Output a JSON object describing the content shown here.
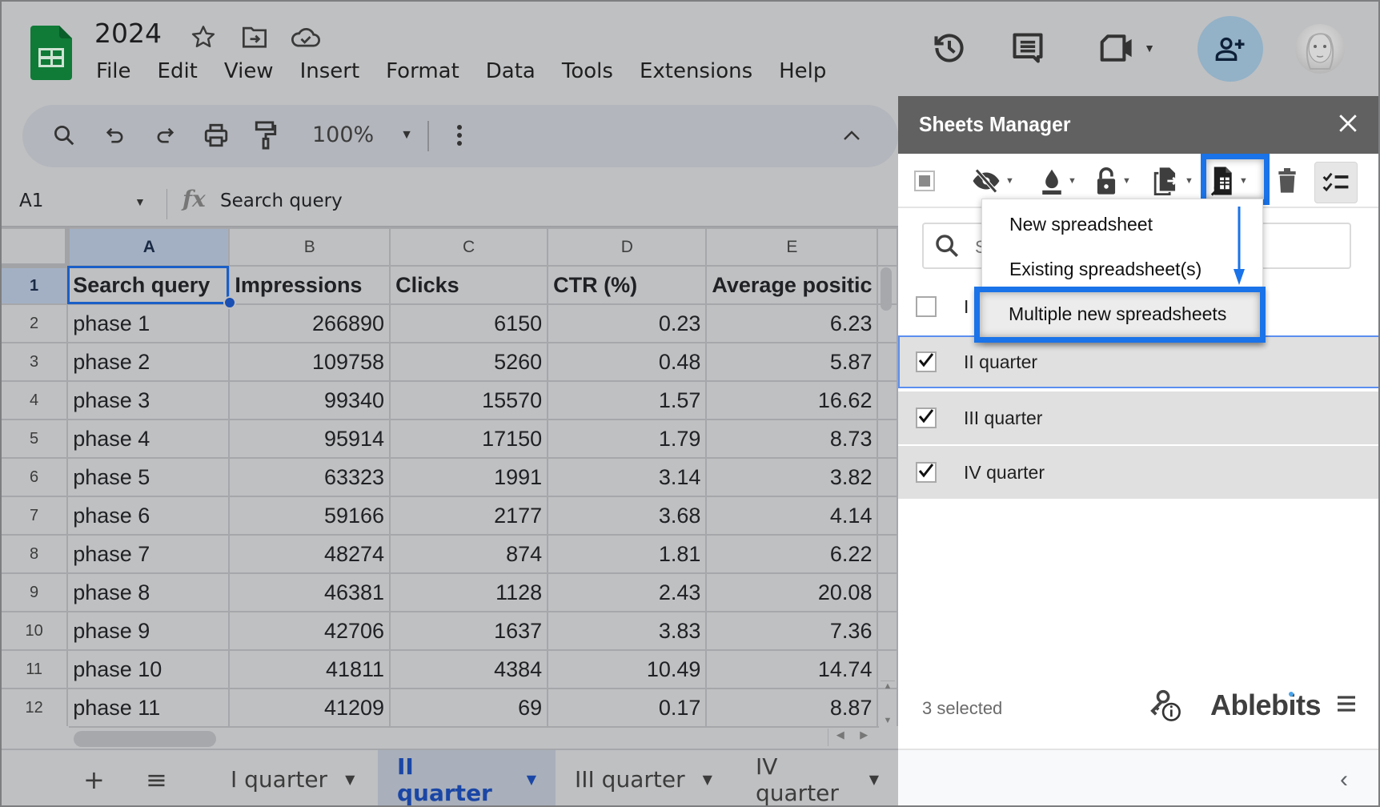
{
  "app": {
    "doc_title": "2024",
    "menu": [
      "File",
      "Edit",
      "View",
      "Insert",
      "Format",
      "Data",
      "Tools",
      "Extensions",
      "Help"
    ],
    "title_icons": [
      "star-icon",
      "move-to-folder-icon",
      "cloud-saved-icon"
    ],
    "top_right_icons": [
      "version-history-icon",
      "comments-icon",
      "meet-icon",
      "share-icon",
      "account-avatar"
    ]
  },
  "toolbar": {
    "zoom": "100%",
    "icons": [
      "search-icon",
      "undo-icon",
      "redo-icon",
      "print-icon",
      "paint-format-icon",
      "more-icon",
      "collapse-icon"
    ]
  },
  "formula_bar": {
    "cell_ref": "A1",
    "fx": "fx",
    "content": "Search query"
  },
  "grid": {
    "columns": [
      "A",
      "B",
      "C",
      "D",
      "E"
    ],
    "active_cell": "A1",
    "rows": [
      {
        "n": "1",
        "cells": [
          "Search query",
          "Impressions",
          "Clicks",
          "CTR (%)",
          "Average positic"
        ]
      },
      {
        "n": "2",
        "cells": [
          "phase 1",
          "266890",
          "6150",
          "0.23",
          "6.23"
        ]
      },
      {
        "n": "3",
        "cells": [
          "phase 2",
          "109758",
          "5260",
          "0.48",
          "5.87"
        ]
      },
      {
        "n": "4",
        "cells": [
          "phase 3",
          "99340",
          "15570",
          "1.57",
          "16.62"
        ]
      },
      {
        "n": "5",
        "cells": [
          "phase 4",
          "95914",
          "17150",
          "1.79",
          "8.73"
        ]
      },
      {
        "n": "6",
        "cells": [
          "phase 5",
          "63323",
          "1991",
          "3.14",
          "3.82"
        ]
      },
      {
        "n": "7",
        "cells": [
          "phase 6",
          "59166",
          "2177",
          "3.68",
          "4.14"
        ]
      },
      {
        "n": "8",
        "cells": [
          "phase 7",
          "48274",
          "874",
          "1.81",
          "6.22"
        ]
      },
      {
        "n": "9",
        "cells": [
          "phase 8",
          "46381",
          "1128",
          "2.43",
          "20.08"
        ]
      },
      {
        "n": "10",
        "cells": [
          "phase 9",
          "42706",
          "1637",
          "3.83",
          "7.36"
        ]
      },
      {
        "n": "11",
        "cells": [
          "phase 10",
          "41811",
          "4384",
          "10.49",
          "14.74"
        ]
      },
      {
        "n": "12",
        "cells": [
          "phase 11",
          "41209",
          "69",
          "0.17",
          "8.87"
        ]
      }
    ]
  },
  "sheet_tabs": {
    "add_label": "+",
    "list_label": "≡",
    "tabs": [
      {
        "label": "I quarter",
        "active": false
      },
      {
        "label": "II quarter",
        "active": true
      },
      {
        "label": "III quarter",
        "active": false
      },
      {
        "label": "IV quarter",
        "active": false
      }
    ]
  },
  "sidebar": {
    "title": "Sheets Manager",
    "close_label": "×",
    "toolbar_icons": [
      "select-all-icon",
      "hide-icon",
      "color-icon",
      "protect-icon",
      "copy-to-icon",
      "export-to-spreadsheet-icon",
      "delete-icon",
      "multi-select-icon"
    ],
    "search_placeholder": "S",
    "items": [
      {
        "label": "I",
        "checked": false
      },
      {
        "label": "II quarter",
        "checked": true
      },
      {
        "label": "III quarter",
        "checked": true
      },
      {
        "label": "IV quarter",
        "checked": true
      }
    ],
    "status": "3 selected",
    "brand": "Ablebits",
    "collapse_label": "‹"
  },
  "dropdown": {
    "items": [
      "New spreadsheet",
      "Existing spreadsheet(s)",
      "Multiple new spreadsheets"
    ],
    "highlighted_index": 2
  },
  "colors": {
    "highlight": "#1a73e8",
    "active_tab_text": "#1a46a5",
    "sheets_green": "#188038",
    "sidebar_header": "#616161",
    "share_button": "#93b1c7"
  }
}
